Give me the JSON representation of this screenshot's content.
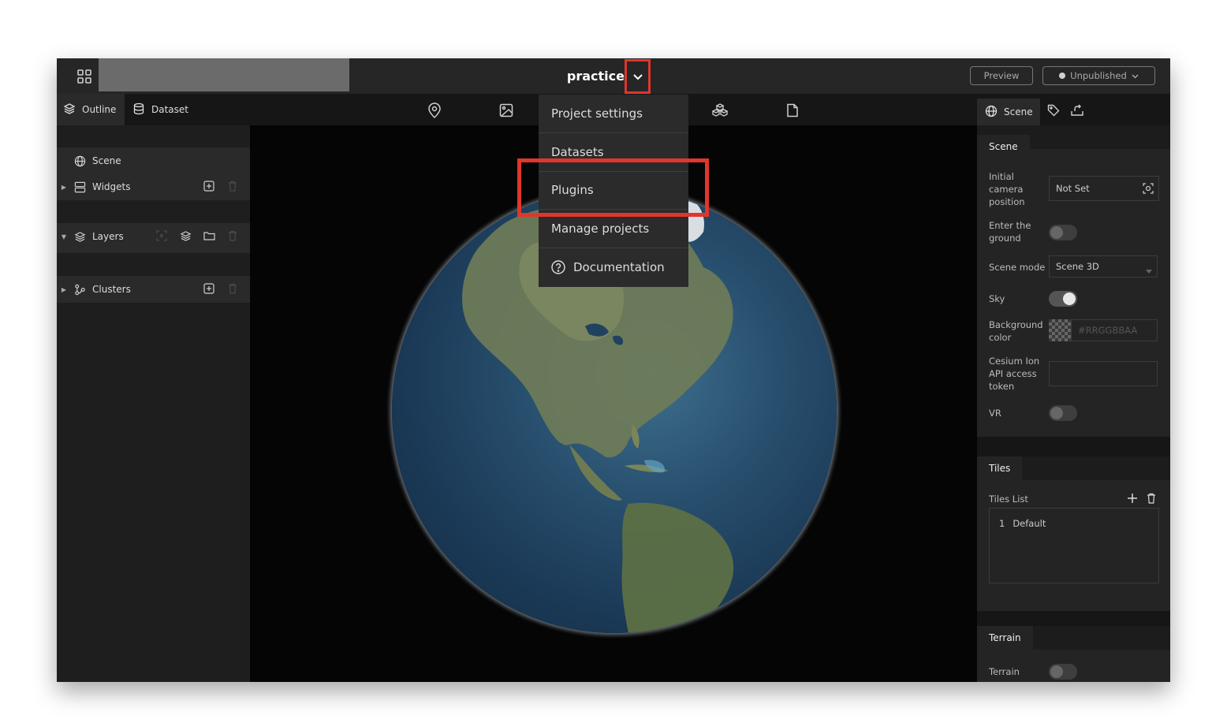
{
  "header": {
    "project_name": "practice",
    "preview_label": "Preview",
    "publish_status": "Unpublished"
  },
  "left_tabs": [
    {
      "label": "Outline",
      "icon": "layers-icon"
    },
    {
      "label": "Dataset",
      "icon": "database-icon"
    }
  ],
  "toolbar_icons": [
    "map-pin-icon",
    "image-icon",
    "cube-cluster-icon",
    "file-icon"
  ],
  "right_tabs": [
    {
      "label": "Scene",
      "icon": "globe-icon"
    },
    {
      "label": "",
      "icon": "tag-icon"
    },
    {
      "label": "",
      "icon": "share-icon"
    }
  ],
  "outline": {
    "scene": "Scene",
    "widgets": "Widgets",
    "layers": "Layers",
    "clusters": "Clusters"
  },
  "project_menu": {
    "items": [
      "Project settings",
      "Datasets",
      "Plugins",
      "Manage projects",
      "Documentation"
    ],
    "highlighted": "Plugins"
  },
  "scene_panel": {
    "section_title": "Scene",
    "initial_camera_label": "Initial camera position",
    "initial_camera_value": "Not Set",
    "enter_ground_label": "Enter the ground",
    "enter_ground_on": false,
    "scene_mode_label": "Scene mode",
    "scene_mode_value": "Scene 3D",
    "sky_label": "Sky",
    "sky_on": true,
    "background_label": "Background color",
    "background_placeholder": "#RRGGBBAA",
    "cesium_label": "Cesium Ion API access token",
    "cesium_value": "",
    "vr_label": "VR",
    "vr_on": false
  },
  "tiles_panel": {
    "section_title": "Tiles",
    "list_label": "Tiles List",
    "items": [
      {
        "index": "1",
        "name": "Default"
      }
    ]
  },
  "terrain_panel": {
    "section_title": "Terrain",
    "terrain_label": "Terrain",
    "terrain_on": false
  },
  "colors": {
    "highlight": "#e0362c",
    "panel_bg": "#242424",
    "viewport_bg": "#050505"
  }
}
